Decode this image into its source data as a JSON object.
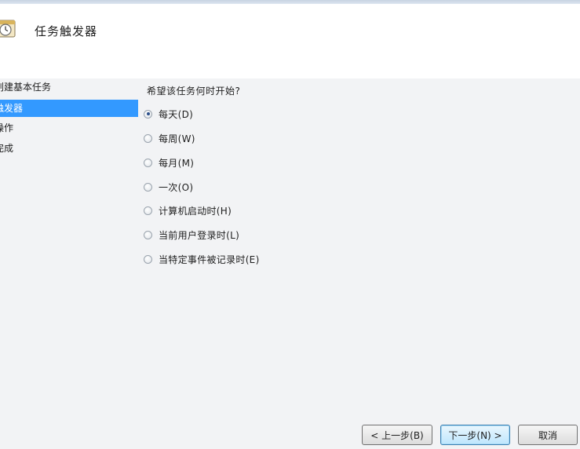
{
  "header": {
    "title": "任务触发器",
    "icon": "clock-calendar-icon"
  },
  "sidebar": {
    "steps": [
      {
        "label": "创建基本任务",
        "active": false
      },
      {
        "label": "触发器",
        "active": true
      },
      {
        "label": "操作",
        "active": false
      },
      {
        "label": "完成",
        "active": false
      }
    ]
  },
  "content": {
    "question": "希望该任务何时开始?",
    "options": [
      {
        "label": "每天(D)",
        "checked": true
      },
      {
        "label": "每周(W)",
        "checked": false
      },
      {
        "label": "每月(M)",
        "checked": false
      },
      {
        "label": "一次(O)",
        "checked": false
      },
      {
        "label": "计算机启动时(H)",
        "checked": false
      },
      {
        "label": "当前用户登录时(L)",
        "checked": false
      },
      {
        "label": "当特定事件被记录时(E)",
        "checked": false
      }
    ]
  },
  "buttons": {
    "back": "< 上一步(B)",
    "next": "下一步(N) >",
    "cancel": "取消"
  },
  "colors": {
    "selection": "#3399ff",
    "panel_background": "#f2f3f5"
  }
}
